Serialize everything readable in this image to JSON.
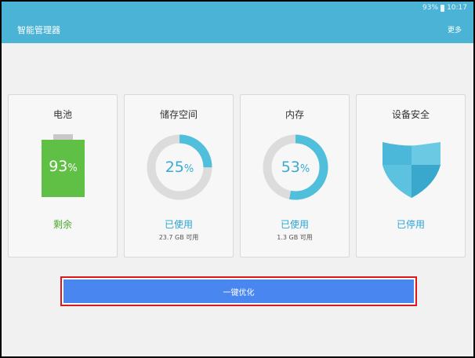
{
  "status_bar": {
    "battery": "93%",
    "time": "10:17"
  },
  "app_bar": {
    "title": "智能管理器",
    "more_label": "更多"
  },
  "cards": {
    "battery": {
      "title": "电池",
      "percent_value": "93",
      "percent_unit": "%",
      "status": "剩余"
    },
    "storage": {
      "title": "储存空间",
      "percent_value": "25",
      "percent_unit": "%",
      "fraction_used": 0.25,
      "status": "已使用",
      "detail": "23.7 GB 可用"
    },
    "ram": {
      "title": "内存",
      "percent_value": "53",
      "percent_unit": "%",
      "fraction_used": 0.53,
      "status": "已使用",
      "detail": "1.3 GB 可用"
    },
    "security": {
      "title": "设备安全",
      "status": "已停用"
    }
  },
  "optimize_button": {
    "label": "一键优化"
  },
  "colors": {
    "app_bar": "#4ab3d6",
    "ring_active": "#4fbfdc",
    "ring_track": "#dcdcdc",
    "battery_fill": "#60bf45",
    "status_green": "#4aa82b",
    "status_blue": "#2aa5d4",
    "button_blue": "#4a86f0",
    "highlight_red": "#e0161b"
  }
}
